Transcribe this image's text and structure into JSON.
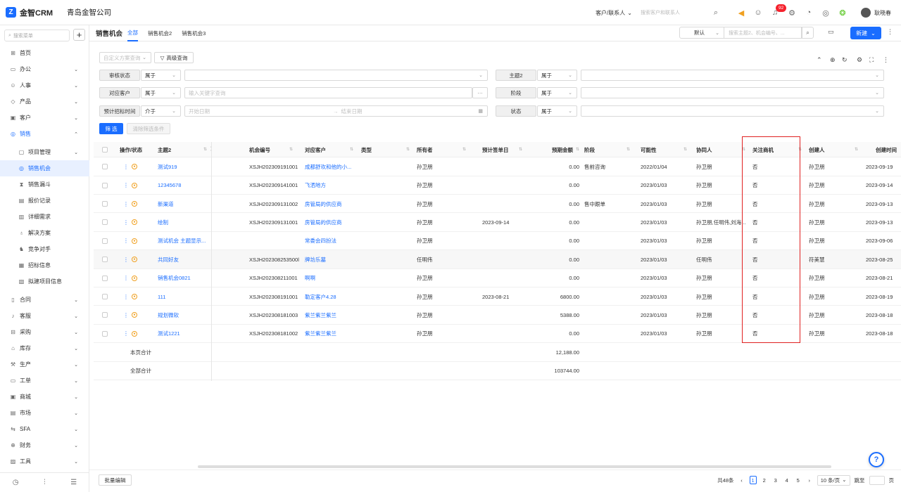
{
  "app": {
    "logo_text": "金智CRM",
    "logo_mark": "Z",
    "company": "青岛金智公司"
  },
  "topbar": {
    "scope_label": "客户/联系人",
    "search_placeholder": "搜索客户和联系人",
    "notification_count": "92",
    "user_name": "耿晓春"
  },
  "sidebar": {
    "search_placeholder": "搜索菜单",
    "items": [
      {
        "label": "首页",
        "icon": "home-icon"
      },
      {
        "label": "办公",
        "icon": "office-icon"
      },
      {
        "label": "人事",
        "icon": "person-icon"
      },
      {
        "label": "产品",
        "icon": "product-icon"
      },
      {
        "label": "客户",
        "icon": "customer-icon"
      },
      {
        "label": "销售",
        "icon": "sales-icon"
      },
      {
        "label": "项目管理",
        "icon": "project-icon"
      },
      {
        "label": "销售机会",
        "icon": "opportunity-icon"
      },
      {
        "label": "销售漏斗",
        "icon": "funnel-icon"
      },
      {
        "label": "报价记录",
        "icon": "quote-icon"
      },
      {
        "label": "详细需求",
        "icon": "requirement-icon"
      },
      {
        "label": "解决方案",
        "icon": "solution-icon"
      },
      {
        "label": "竞争对手",
        "icon": "competitor-icon"
      },
      {
        "label": "招标信息",
        "icon": "bid-icon"
      },
      {
        "label": "拟建项目信息",
        "icon": "planned-project-icon"
      },
      {
        "label": "合同",
        "icon": "contract-icon"
      },
      {
        "label": "客服",
        "icon": "service-icon"
      },
      {
        "label": "采购",
        "icon": "purchase-icon"
      },
      {
        "label": "库存",
        "icon": "inventory-icon"
      },
      {
        "label": "生产",
        "icon": "production-icon"
      },
      {
        "label": "工单",
        "icon": "workorder-icon"
      },
      {
        "label": "商城",
        "icon": "mall-icon"
      },
      {
        "label": "市场",
        "icon": "market-icon"
      },
      {
        "label": "SFA",
        "icon": "sfa-icon"
      },
      {
        "label": "财务",
        "icon": "finance-icon"
      },
      {
        "label": "工具",
        "icon": "tool-icon"
      }
    ]
  },
  "tabs": {
    "title": "销售机会",
    "items": [
      "全部",
      "销售机会2",
      "销售机会3"
    ]
  },
  "toolbar": {
    "view_value": "默认",
    "keyword_placeholder": "搜索主题2、机会编号、...",
    "new_label": "新建"
  },
  "filters": {
    "custom_query_placeholder": "自定义方案查询",
    "advanced_query": "高级查询",
    "rows": [
      {
        "label": "审核状态",
        "op": "属于",
        "value": ""
      },
      {
        "label": "主题2",
        "op": "属于",
        "value": ""
      },
      {
        "label": "对应客户",
        "op": "属于",
        "value": "输入关键字查询"
      },
      {
        "label": "阶段",
        "op": "属于",
        "value": ""
      },
      {
        "label": "预计招标时间",
        "op": "介于",
        "start": "开始日期",
        "end": "结束日期"
      },
      {
        "label": "状态",
        "op": "属于",
        "value": ""
      }
    ],
    "filter_btn": "筛 选",
    "clear_btn": "清除筛选条件"
  },
  "table": {
    "columns": [
      "操作/状态",
      "主题2",
      "机会编号",
      "对应客户",
      "类型",
      "所有者",
      "预计签单日",
      "预期金额",
      "阶段",
      "可能性",
      "协同人",
      "关注商机",
      "创建人",
      "创建时间"
    ],
    "rows": [
      [
        "测试919",
        "XSJH202309191001",
        "成都舒欢和他的小...",
        "",
        "孙卫朋",
        "",
        "0.00",
        "售前咨询",
        "2022/01/04",
        "孙卫朋",
        "否",
        "孙卫朋",
        "2023-09-19"
      ],
      [
        "12345678",
        "XSJH202309141001",
        "飞洒地方",
        "",
        "孙卫朋",
        "",
        "0.00",
        "",
        "2023/01/03",
        "孙卫朋",
        "否",
        "孙卫朋",
        "2023-09-14"
      ],
      [
        "新渠道",
        "XSJH202309131002",
        "房管局的供应商",
        "",
        "孙卫朋",
        "",
        "0.00",
        "售中跟单",
        "2023/01/03",
        "孙卫朋",
        "否",
        "孙卫朋",
        "2023-09-13"
      ],
      [
        "绘制",
        "XSJH202309131001",
        "房管局的供应商",
        "",
        "孙卫朋",
        "2023-09-14",
        "0.00",
        "",
        "2023/01/03",
        "孙卫朋,任明伟,刘海...",
        "否",
        "孙卫朋",
        "2023-09-13"
      ],
      [
        "测试机会 主题显示...",
        "",
        "常委会四扮法",
        "",
        "孙卫朋",
        "",
        "0.00",
        "",
        "2023/01/03",
        "孙卫朋",
        "否",
        "孙卫朋",
        "2023-09-06"
      ],
      [
        "共同好友",
        "XSJH202308253500l",
        "牌坊乐墓",
        "",
        "任明伟",
        "",
        "0.00",
        "",
        "2023/01/03",
        "任明伟",
        "否",
        "符美慧",
        "2023-08-25"
      ],
      [
        "销售机会0821",
        "XSJH202308211001",
        "啊啊",
        "",
        "孙卫朋",
        "",
        "0.00",
        "",
        "2023/01/03",
        "孙卫朋",
        "否",
        "孙卫朋",
        "2023-08-21"
      ],
      [
        "111",
        "XSJH202308191001",
        "勒定客户4.28",
        "",
        "孙卫朋",
        "2023-08-21",
        "6800.00",
        "",
        "2023/01/03",
        "孙卫朋",
        "否",
        "孙卫朋",
        "2023-08-19"
      ],
      [
        "规划微软",
        "XSJH202308181003",
        "紫兰紫兰紫兰",
        "",
        "孙卫朋",
        "",
        "5388.00",
        "",
        "2023/01/03",
        "孙卫朋",
        "否",
        "孙卫朋",
        "2023-08-18"
      ],
      [
        "测试1221",
        "XSJH202308181002",
        "紫兰紫兰紫兰",
        "",
        "孙卫朋",
        "",
        "0.00",
        "",
        "2023/01/03",
        "孙卫朋",
        "否",
        "孙卫朋",
        "2023-08-18"
      ]
    ],
    "page_total_label": "本页合计",
    "page_total_value": "12,188.00",
    "all_total_label": "全部合计",
    "all_total_value": "103744.00"
  },
  "footer": {
    "batch_edit": "批量编辑",
    "total": "共48条",
    "pages": [
      "1",
      "2",
      "3",
      "4",
      "5"
    ],
    "page_size": "10 条/页",
    "jump_label": "跳至",
    "page_unit": "页"
  },
  "colors": {
    "accent": "#1a6dff",
    "highlight_border": "#e02020"
  }
}
